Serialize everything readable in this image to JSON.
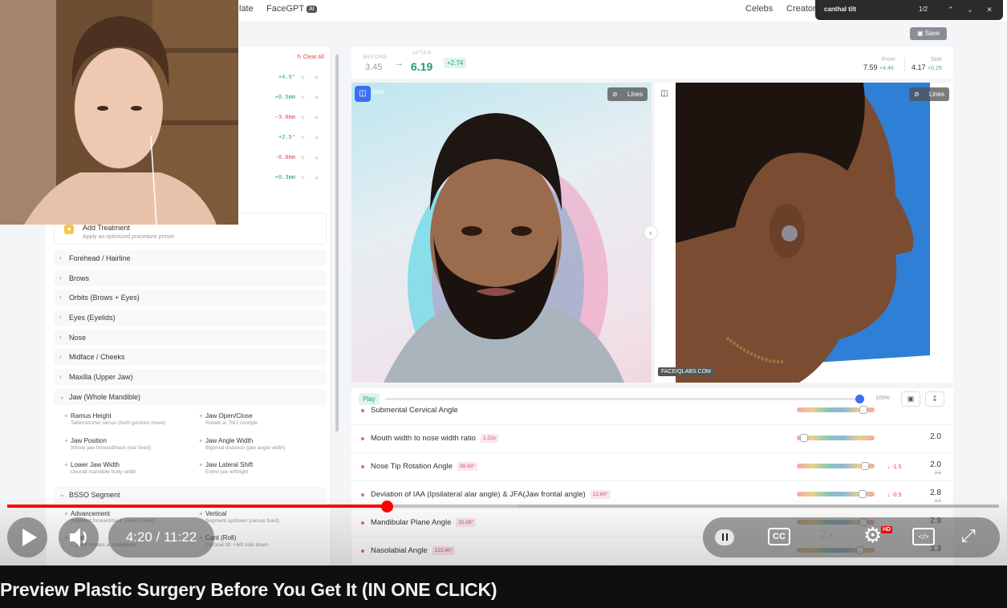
{
  "nav": {
    "tab_partial": "late",
    "facegpt": "FaceGPT",
    "ai_badge": "AI",
    "celebs": "Celebs",
    "creators": "Creator"
  },
  "findbar": {
    "query": "canthal tilt",
    "count": "1/2"
  },
  "save_label": "Save",
  "adjustments": {
    "clear_all": "Clear All",
    "values": [
      "+4.5°",
      "+0.5mm",
      "-3.0mm",
      "+2.5°",
      "-6.0mm",
      "+0.3mm"
    ]
  },
  "treatment": {
    "title": "Add Treatment",
    "subtitle": "Apply an optimized procedure preset"
  },
  "categories": [
    "Forehead / Hairline",
    "Brows",
    "Orbits (Brows + Eyes)",
    "Eyes (Eyelids)",
    "Nose",
    "Midface / Cheeks",
    "Maxilla (Upper Jaw)",
    "Jaw (Whole Mandible)",
    "BSSO Segment"
  ],
  "jaw_items": [
    {
      "title": "Ramus Height",
      "desc": "Taller/shorter ramus (both gonions move)"
    },
    {
      "title": "Jaw Open/Close",
      "desc": "Rotate at TMJ condyle"
    },
    {
      "title": "Jaw Position",
      "desc": "Whole jaw forward/back (ear fixed)"
    },
    {
      "title": "Jaw Angle Width",
      "desc": "Bigonial distance (jaw angle width)"
    },
    {
      "title": "Lower Jaw Width",
      "desc": "Overall mandible body width"
    },
    {
      "title": "Jaw Lateral Shift",
      "desc": "Entire jaw left/right"
    }
  ],
  "bsso_items": [
    {
      "title": "Advancement",
      "desc": "Segment forward/back (ramus fixed)"
    },
    {
      "title": "Vertical",
      "desc": "Segment up/down (ramus fixed)"
    },
    {
      "title": "…ion",
      "desc": "…ment rotates at sublabiale"
    },
    {
      "title": "Cant (Roll)",
      "desc": "Coronal tilt: +left side down"
    }
  ],
  "scores": {
    "before_label": "BEFORE",
    "before": "3.45",
    "after_label": "AFTER",
    "after": "6.19",
    "delta": "+2.74",
    "front_label": "Front",
    "front": "7.59",
    "front_delta": "+4.46",
    "side_label": "Side",
    "side": "4.17",
    "side_delta": "+0.25"
  },
  "photos": {
    "lines_label": "Lines",
    "before_partial": "ORE",
    "caption": "FACEIQLABS.COM"
  },
  "player": {
    "play": "Play",
    "percent": "100%",
    "level": 1.0
  },
  "metrics": [
    {
      "name": "Submental Cervical Angle",
      "chip": "",
      "delta": "",
      "score": "",
      "prev": "",
      "knob": 0.9
    },
    {
      "name": "Mouth width to nose width ratio",
      "chip": "1.22x",
      "delta": "",
      "score": "2.0",
      "prev": "",
      "knob": 0.05
    },
    {
      "name": "Nose Tip Rotation Angle",
      "chip": "39.43°",
      "delta": "↓ -1.5",
      "score": "2.0",
      "prev": "3.5",
      "knob": 0.92
    },
    {
      "name": "Deviation of IAA (Ipsilateral alar angle) & JFA(Jaw frontal angle)",
      "chip": "12.60°",
      "delta": "↓ -0.5",
      "score": "2.8",
      "prev": "3.3",
      "knob": 0.88
    },
    {
      "name": "Mandibular Plane Angle",
      "chip": "31.89°",
      "delta": "",
      "score": "2.9",
      "prev": "",
      "knob": 0.9
    },
    {
      "name": "Nasolabial Angle",
      "chip": "122.40°",
      "delta": "",
      "score": "3.3",
      "prev": "",
      "knob": 0.85
    }
  ],
  "video": {
    "time": "4:20 / 11:22",
    "played_fraction": 0.383,
    "buffered_fraction": 0.515,
    "speed": "2x",
    "hd": "HD",
    "title": "Preview Plastic Surgery Before You Get It (IN ONE CLICK)"
  },
  "colors": {
    "accent": "#3b6ff5",
    "positive": "#1e9e6a",
    "negative": "#e04848",
    "progress": "#ff0000"
  }
}
